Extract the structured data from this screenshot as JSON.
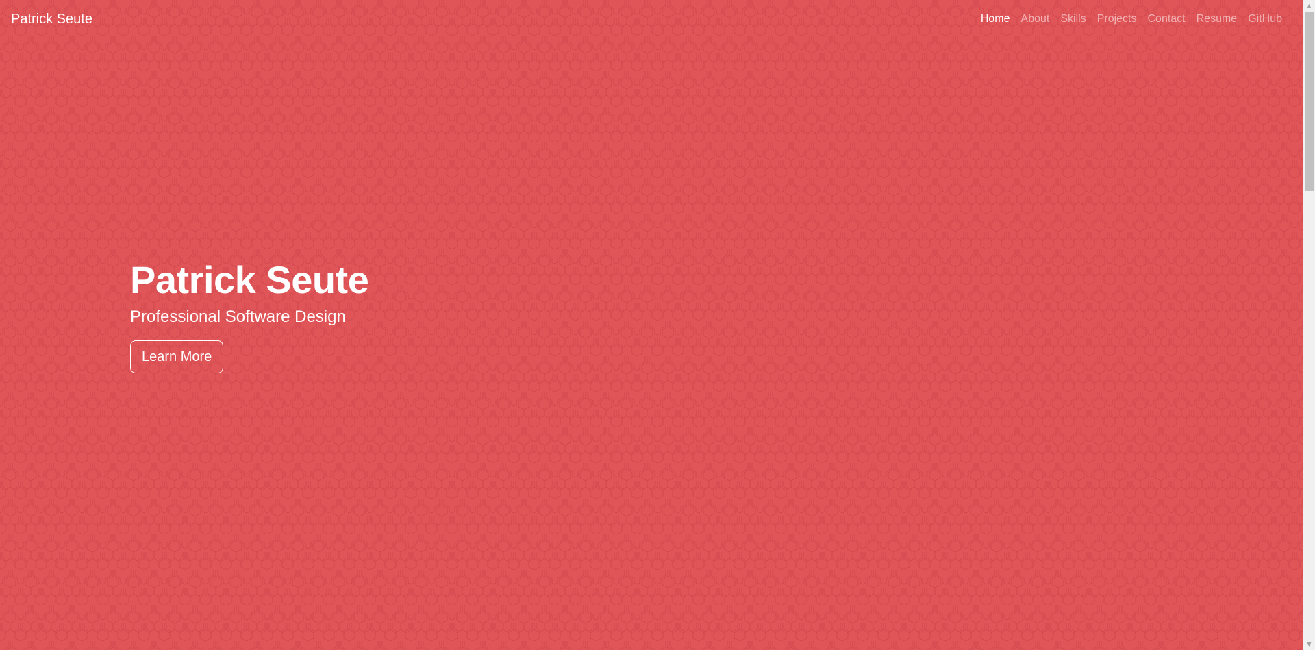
{
  "site": {
    "brand": "Patrick Seute",
    "background_color": "#e05558",
    "pattern_line_color": "#c9424a"
  },
  "nav": {
    "items": [
      {
        "label": "Home",
        "active": true
      },
      {
        "label": "About",
        "active": false
      },
      {
        "label": "Skills",
        "active": false
      },
      {
        "label": "Projects",
        "active": false
      },
      {
        "label": "Contact",
        "active": false
      },
      {
        "label": "Resume",
        "active": false
      },
      {
        "label": "GitHub",
        "active": false
      }
    ]
  },
  "hero": {
    "title": "Patrick Seute",
    "subtitle": "Professional Software Design",
    "button_label": "Learn More"
  },
  "scrollbar": {
    "up_icon": "triangle-up-icon",
    "down_icon": "triangle-down-icon",
    "up_glyph": "▲",
    "down_glyph": "▼"
  }
}
